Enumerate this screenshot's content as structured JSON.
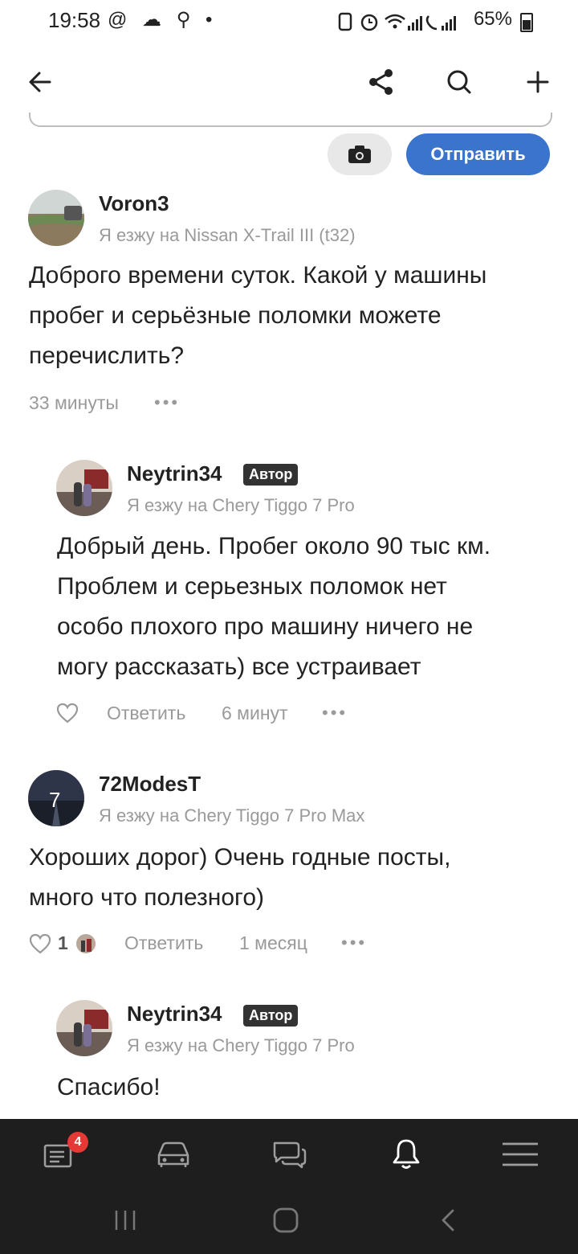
{
  "status_bar": {
    "time": "19:58",
    "left_icons": "@ ☁ ⚲ •",
    "battery": "65%",
    "icons": [
      "at-icon",
      "weather-icon",
      "search-icon",
      "dot-icon",
      "saver-icon",
      "alarm-icon",
      "wifi-icon",
      "signal-icon",
      "call-signal-icon",
      "battery-icon"
    ]
  },
  "toolbar": {
    "back_icon": "arrow-left-icon",
    "share_icon": "share-icon",
    "search_icon": "search-icon",
    "add_icon": "plus-icon"
  },
  "composer": {
    "camera_icon": "camera-icon",
    "send_label": "Отправить"
  },
  "comments": [
    {
      "user": "Voron3",
      "drives": "Я езжу на Nissan X-Trail III (t32)",
      "text_lines": [
        "Доброго времени суток. Какой у машины",
        "пробег и серьёзные поломки можете",
        "перечислить?"
      ],
      "time": "33 минуты",
      "more": "•••"
    },
    {
      "user": "Neytrin34",
      "badge": "Автор",
      "drives": "Я езжу на Chery Tiggo 7 Pro",
      "text_lines": [
        "Добрый день. Пробег около 90 тыс км.",
        "Проблем и серьезных поломок нет",
        "особо плохого про машину ничего не",
        "могу рассказать) все устраивает"
      ],
      "reply": "Ответить",
      "time": "6 минут",
      "more": "•••"
    },
    {
      "user": "72ModesT",
      "avatar_letter": "7",
      "drives": "Я езжу на Chery Tiggo 7 Pro Max",
      "text_lines": [
        "Хороших дорог) Очень годные посты,",
        "много что полезного)"
      ],
      "likes": "1",
      "reply": "Ответить",
      "time": "1 месяц",
      "more": "•••"
    },
    {
      "user": "Neytrin34",
      "badge": "Автор",
      "drives": "Я езжу на Chery Tiggo 7 Pro",
      "text_lines": [
        "Спасибо!"
      ]
    }
  ],
  "bottom_nav": {
    "items": [
      "feed-icon",
      "car-icon",
      "chat-icon",
      "bell-icon",
      "menu-icon"
    ],
    "badge": "4",
    "active_color": "#ffffff",
    "inactive_color": "#9e9e9e"
  },
  "system_nav": [
    "recents-icon",
    "home-icon",
    "back-icon"
  ],
  "colors": {
    "accent": "#3a74cc",
    "badge": "#e53935",
    "nav_bg": "#1e1e1e"
  }
}
